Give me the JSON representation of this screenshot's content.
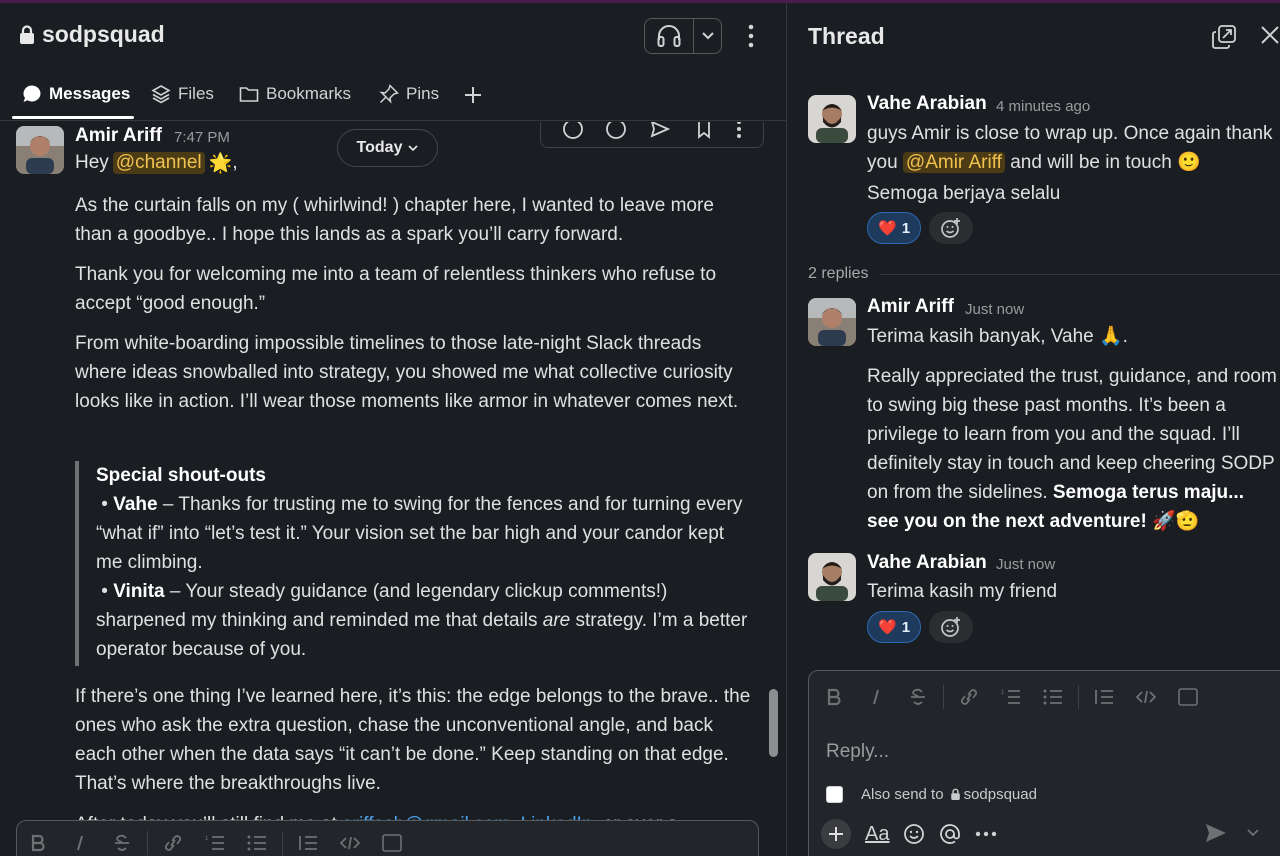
{
  "channel": {
    "name": "sodpsquad",
    "tabs": [
      {
        "label": "Messages",
        "icon": "chat-bubble-icon"
      },
      {
        "label": "Files",
        "icon": "layers-icon"
      },
      {
        "label": "Bookmarks",
        "icon": "folder-icon"
      },
      {
        "label": "Pins",
        "icon": "pin-icon"
      }
    ],
    "date_pill": "Today"
  },
  "message": {
    "author": "Amir Ariff",
    "time": "7:47 PM",
    "greeting": "Hey",
    "greeting_mention": "@channel",
    "greeting_emoji": "🌟",
    "greeting_tail": ",",
    "p1": "As the curtain falls on my ( whirlwind! ) chapter here, I wanted to leave more than a goodbye.. I hope this lands as a spark you’ll carry forward.",
    "p2": "Thank you for welcoming me into a team of relentless thinkers who refuse to accept “good enough.”",
    "p3": "From white-boarding impossible timelines to those late-night Slack threads where ideas snowballed into strategy, you showed me what collective curiosity looks like in action. I’ll wear those moments like armor in whatever comes next.",
    "quote": {
      "heading": "Special shout-outs",
      "b1_name": "Vahe",
      "b1_text": " – Thanks for trusting me to swing for the fences and for turning every “what if” into “let’s test it.” Your vision set the bar high and your candor kept me climbing.",
      "b2_name": "Vinita",
      "b2_text_a": " – Your steady guidance (and legendary clickup comments!) sharpened my thinking and reminded me that details ",
      "b2_em": "are",
      "b2_text_b": " strategy. I’m a better operator because of you."
    },
    "p4": "If there’s one thing I’ve learned here, it’s this: the edge belongs to the brave.. the ones who ask the extra question, chase the unconventional angle, and back each other when the data says “it can’t be done.” Keep standing on that edge. That’s where the breakthroughs live.",
    "p5_pre": "After today you’ll still find me at",
    "p5_email": "ariffash@gmail.com",
    "p5_link": "LinkedIn",
    "p5_post": ", or over a"
  },
  "thread": {
    "title": "Thread",
    "parent": {
      "author": "Vahe Arabian",
      "time": "4 minutes ago",
      "line1": "guys Amir is close to wrap up. Once again thank",
      "line2_pre": "you",
      "line2_mention": "@Amir Ariff",
      "line2_post": "and will be in touch",
      "line2_emoji": "🙂",
      "line3": "Semoga berjaya selalu",
      "reaction_emoji": "❤️",
      "reaction_count": "1"
    },
    "replies_label": "2 replies",
    "reply1": {
      "author": "Amir Ariff",
      "time": "Just now",
      "line1": "Terima kasih banyak, Vahe",
      "line1_emoji": "🙏",
      "line1_tail": ".",
      "body": "Really appreciated the trust, guidance, and room to swing big these past months. It’s been a privilege to learn from you and the squad. I’ll definitely stay in touch and keep cheering SODP on from the sidelines.",
      "body_bold": "Semoga terus maju... see you on the next adventure!",
      "body_emoji": "🚀🫡"
    },
    "reply2": {
      "author": "Vahe Arabian",
      "time": "Just now",
      "text": "Terima kasih my friend",
      "reaction_emoji": "❤️",
      "reaction_count": "1"
    },
    "composer": {
      "placeholder": "Reply...",
      "also_send_label": "Also send to",
      "also_send_channel": "sodpsquad",
      "aa_label": "Aa"
    }
  },
  "colors": {
    "background": "#1a1d21",
    "mention_bg": "#4c3c15",
    "mention_fg": "#f1c24f",
    "link": "#4aa3f0",
    "reaction_bg": "#1e3a5c"
  }
}
